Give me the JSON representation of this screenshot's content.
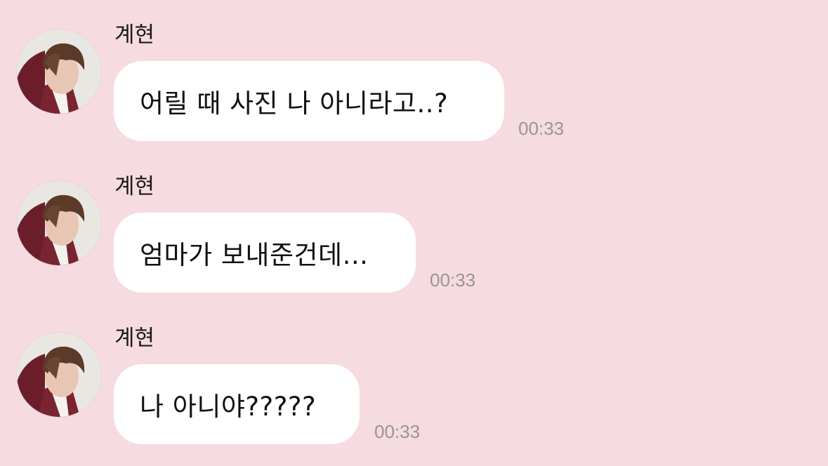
{
  "colors": {
    "background": "#f6dbe1",
    "bubble": "#ffffff",
    "text": "#111111",
    "timestamp": "#9a9494"
  },
  "messages": [
    {
      "sender": "계현",
      "text": "어릴 때 사진 나 아니라고..?",
      "time": "00:33"
    },
    {
      "sender": "계현",
      "text": "엄마가 보내준건데...",
      "time": "00:33"
    },
    {
      "sender": "계현",
      "text": "나 아니야?????",
      "time": "00:33"
    }
  ]
}
